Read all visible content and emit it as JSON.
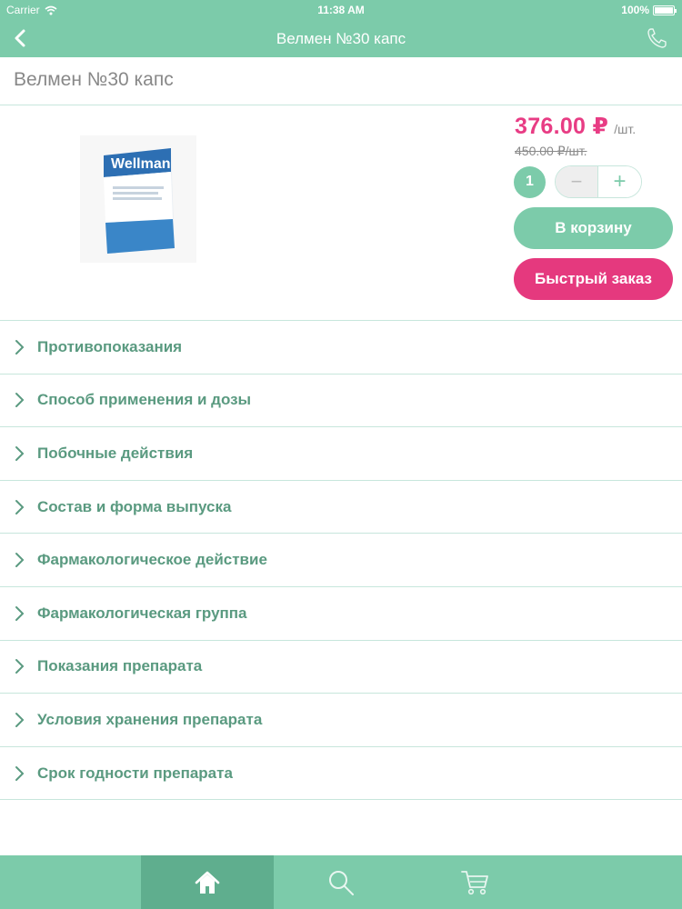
{
  "status": {
    "carrier": "Carrier",
    "time": "11:38 AM",
    "battery": "100%"
  },
  "nav": {
    "title": "Велмен №30 капс"
  },
  "product": {
    "title": "Велмен №30 капс",
    "price": "376.00 ₽",
    "unit": "/шт.",
    "old_price": "450.00 ₽/шт.",
    "quantity": "1",
    "minus_label": "−",
    "plus_label": "+",
    "cart_button": "В корзину",
    "quick_order_button": "Быстрый заказ",
    "image_label": "Wellman"
  },
  "sections": [
    {
      "label": "Противопоказания"
    },
    {
      "label": "Способ применения и дозы"
    },
    {
      "label": "Побочные действия"
    },
    {
      "label": "Состав и форма выпуска"
    },
    {
      "label": "Фармакологическое действие"
    },
    {
      "label": "Фармакологическая группа"
    },
    {
      "label": "Показания препарата"
    },
    {
      "label": "Условия хранения препарата"
    },
    {
      "label": "Срок годности препарата"
    }
  ],
  "tabs": {
    "active": "home",
    "items": [
      "home-icon",
      "search-icon",
      "cart-icon"
    ]
  },
  "colors": {
    "accent": "#7ccbaa",
    "accent_dark": "#5fae8e",
    "price": "#e83c84",
    "quick_order": "#e5397e",
    "list_text": "#5a9a80"
  }
}
